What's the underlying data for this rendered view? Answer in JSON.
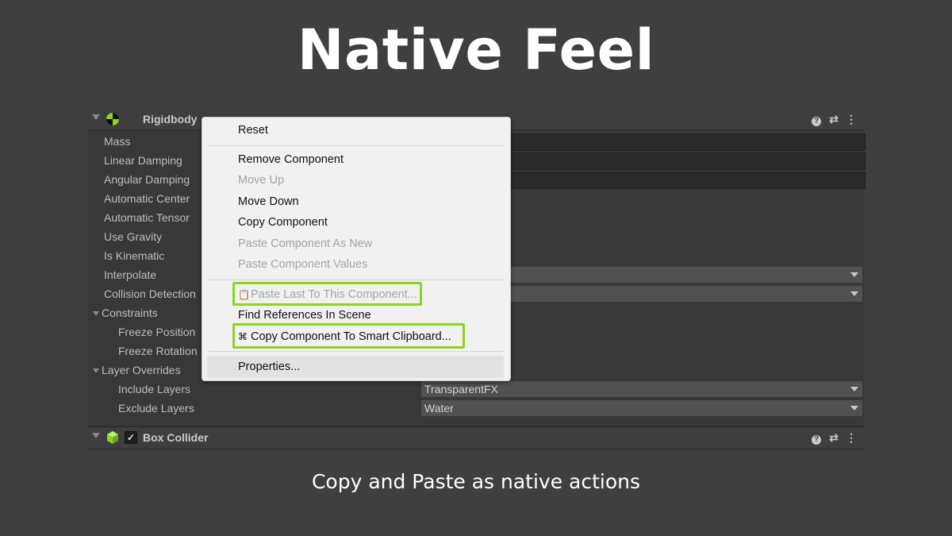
{
  "headline": "Native Feel",
  "caption": "Copy and Paste as native actions",
  "colors": {
    "background": "#3f3f3f",
    "highlight": "#8ed324",
    "menu_bg": "#f1f1f1"
  },
  "rigidbody": {
    "title": "Rigidbody",
    "icon": "rigidbody-icon",
    "properties": [
      "Mass",
      "Linear Damping",
      "Angular Damping",
      "Automatic Center",
      "Automatic Tensor",
      "Use Gravity",
      "Is Kinematic",
      "Interpolate",
      "Collision Detection",
      "Constraints",
      "Freeze Position",
      "Freeze Rotation",
      "Layer Overrides",
      "Include Layers",
      "Exclude Layers"
    ],
    "include_layers_value": "TransparentFX",
    "exclude_layers_value": "Water"
  },
  "box_collider": {
    "title": "Box Collider",
    "icon": "box-collider-icon",
    "checked": "✓"
  },
  "header_icons": {
    "help": "?",
    "presets": "⇄",
    "more": "⋮"
  },
  "context_menu": {
    "reset": "Reset",
    "remove_component": "Remove Component",
    "move_up": "Move Up",
    "move_down": "Move Down",
    "copy_component": "Copy Component",
    "paste_as_new": "Paste Component As New",
    "paste_values": "Paste Component Values",
    "paste_last": "Paste Last To This Component...",
    "find_references": "Find References In Scene",
    "copy_to_smart_clipboard": "Copy Component To Smart Clipboard...",
    "properties": "Properties..."
  }
}
